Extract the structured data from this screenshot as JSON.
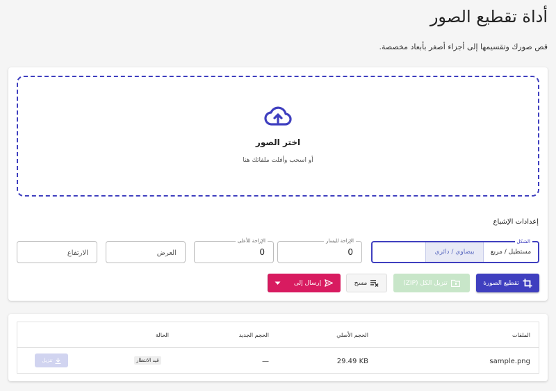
{
  "page": {
    "title": "أداة تقطيع الصور",
    "subtitle": "قص صورك وتقسيمها إلى أجزاء أصغر بأبعاد مخصصة."
  },
  "upload": {
    "title": "اختر الصور",
    "subtitle": "أو اسحب وأفلت ملفاتك هنا",
    "icon": "cloud-upload-icon"
  },
  "settings": {
    "section_label": "إعدادات الإشباع",
    "shape": {
      "label": "الشكل",
      "options": [
        "مستطيل / مربع",
        "بيضاوي / دائري"
      ],
      "selected": "بيضاوي / دائري"
    },
    "offset_x": {
      "label": "الإزاحة لليسار",
      "value": "0"
    },
    "offset_y": {
      "label": "الإزاحة للأعلى",
      "value": "0"
    },
    "width": {
      "placeholder": "العرض"
    },
    "height": {
      "placeholder": "الارتفاع"
    }
  },
  "actions": {
    "crop_label": "تقطيع الصورة",
    "zip_label": "تنزيل الكل (ZIP)",
    "clear_label": "مسح",
    "send_label": "إرسال إلى"
  },
  "table": {
    "headers": {
      "files": "الملفات",
      "original_size": "الحجم الأصلي",
      "new_size": "الحجم الجديد",
      "status": "الحالة"
    },
    "rows": [
      {
        "file": "sample.png",
        "original_size": "29.49 KB",
        "new_size": "—",
        "status": "قيد الانتظار",
        "download_label": "تنزيل"
      }
    ]
  },
  "colors": {
    "primary": "#3f3fbf",
    "send": "#d81b60",
    "zip_disabled": "#c8e6c9",
    "download_disabled": "#d1d4f0"
  }
}
